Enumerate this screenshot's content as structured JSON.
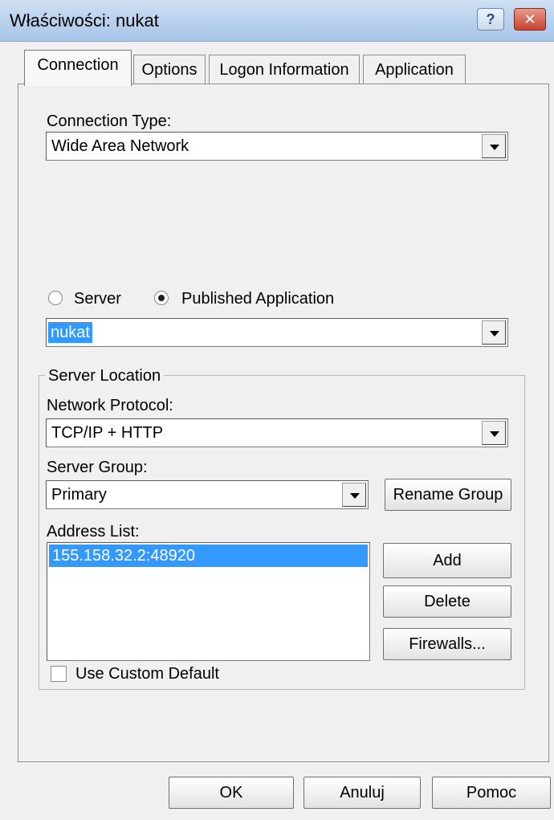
{
  "window": {
    "title": "Właściwości: nukat",
    "help_glyph": "?",
    "close_glyph": "✕"
  },
  "tabs": [
    {
      "label": "Connection",
      "active": true
    },
    {
      "label": "Options",
      "active": false
    },
    {
      "label": "Logon Information",
      "active": false
    },
    {
      "label": "Application",
      "active": false
    }
  ],
  "connection": {
    "type_label": "Connection Type:",
    "type_value": "Wide Area Network",
    "server_radio_label": "Server",
    "published_radio_label": "Published Application",
    "selected_radio": "Published Application",
    "application_value": "nukat"
  },
  "server_location": {
    "legend": "Server Location",
    "protocol_label": "Network Protocol:",
    "protocol_value": "TCP/IP + HTTP",
    "group_label": "Server Group:",
    "group_value": "Primary",
    "rename_button": "Rename Group",
    "address_label": "Address List:",
    "addresses": [
      "155.158.32.2:48920"
    ],
    "add_button": "Add",
    "delete_button": "Delete",
    "firewalls_button": "Firewalls...",
    "use_custom_default_label": "Use Custom Default",
    "use_custom_default_checked": false
  },
  "footer": {
    "ok": "OK",
    "cancel": "Anuluj",
    "help": "Pomoc"
  }
}
